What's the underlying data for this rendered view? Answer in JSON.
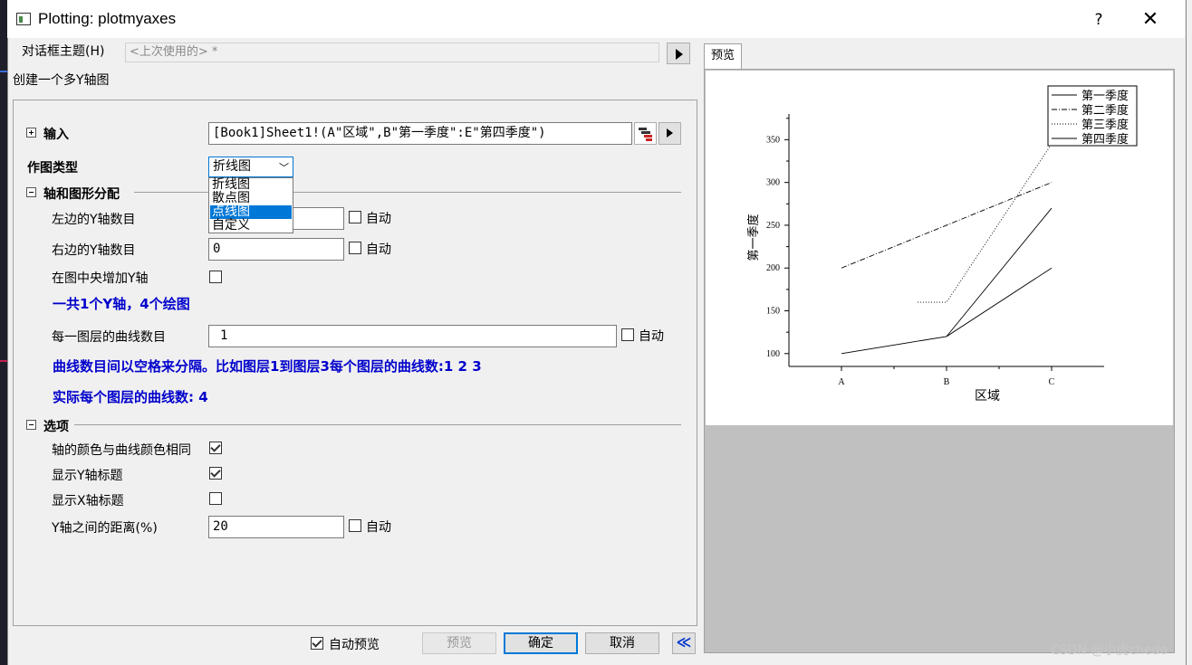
{
  "window": {
    "title": "Plotting: plotmyaxes",
    "help_symbol": "?",
    "close_symbol": "✕"
  },
  "dialog_theme": {
    "label": "对话框主题(H)",
    "value": "<上次使用的> *"
  },
  "description": "创建一个多Y轴图",
  "input": {
    "label": "输入",
    "value": "[Book1]Sheet1!(A\"区域\",B\"第一季度\":E\"第四季度\")"
  },
  "plot_type": {
    "label": "作图类型",
    "selected": "折线图",
    "options": [
      "折线图",
      "散点图",
      "点线图",
      "自定义"
    ],
    "highlighted_index": 2
  },
  "axes_section": {
    "label": "轴和图形分配",
    "left_y_label": "左边的Y轴数目",
    "left_y_value": "",
    "right_y_label": "右边的Y轴数目",
    "right_y_value": "0",
    "auto_label": "自动",
    "center_y_label": "在图中央增加Y轴",
    "summary": "一共1个Y轴，4个绘图",
    "curves_per_layer_label": "每一图层的曲线数目",
    "curves_per_layer_value": "1",
    "hint": "曲线数目间以空格来分隔。比如图层1到图层3每个图层的曲线数:1 2 3",
    "actual": "实际每个图层的曲线数: 4"
  },
  "options_section": {
    "label": "选项",
    "axis_color_label": "轴的颜色与曲线颜色相同",
    "axis_color_checked": true,
    "show_y_title_label": "显示Y轴标题",
    "show_y_title_checked": true,
    "show_x_title_label": "显示X轴标题",
    "show_x_title_checked": false,
    "y_distance_label": "Y轴之间的距离(%)",
    "y_distance_value": "20"
  },
  "footer": {
    "auto_preview_label": "自动预览",
    "auto_preview_checked": true,
    "preview_btn": "预览",
    "ok_btn": "确定",
    "cancel_btn": "取消",
    "collapse_symbol": "≪"
  },
  "preview": {
    "tab_label": "预览"
  },
  "chart_data": {
    "type": "line",
    "categories": [
      "A",
      "B",
      "C"
    ],
    "xlabel": "区域",
    "ylabel": "第一季度",
    "ylim": [
      85,
      380
    ],
    "yticks": [
      100,
      150,
      200,
      250,
      300,
      350
    ],
    "legend_position": "top-right",
    "series": [
      {
        "name": "第一季度",
        "values": [
          100,
          120,
          200
        ],
        "dash": "solid"
      },
      {
        "name": "第二季度",
        "values": [
          200,
          250,
          300
        ],
        "dash": "dashdot"
      },
      {
        "name": "第三季度",
        "values": [
          null,
          160,
          345
        ],
        "dash": "dotted"
      },
      {
        "name": "第四季度",
        "values": [
          null,
          120,
          270
        ],
        "dash": "solid"
      }
    ]
  },
  "watermark": "CSDN @小虎chedo"
}
